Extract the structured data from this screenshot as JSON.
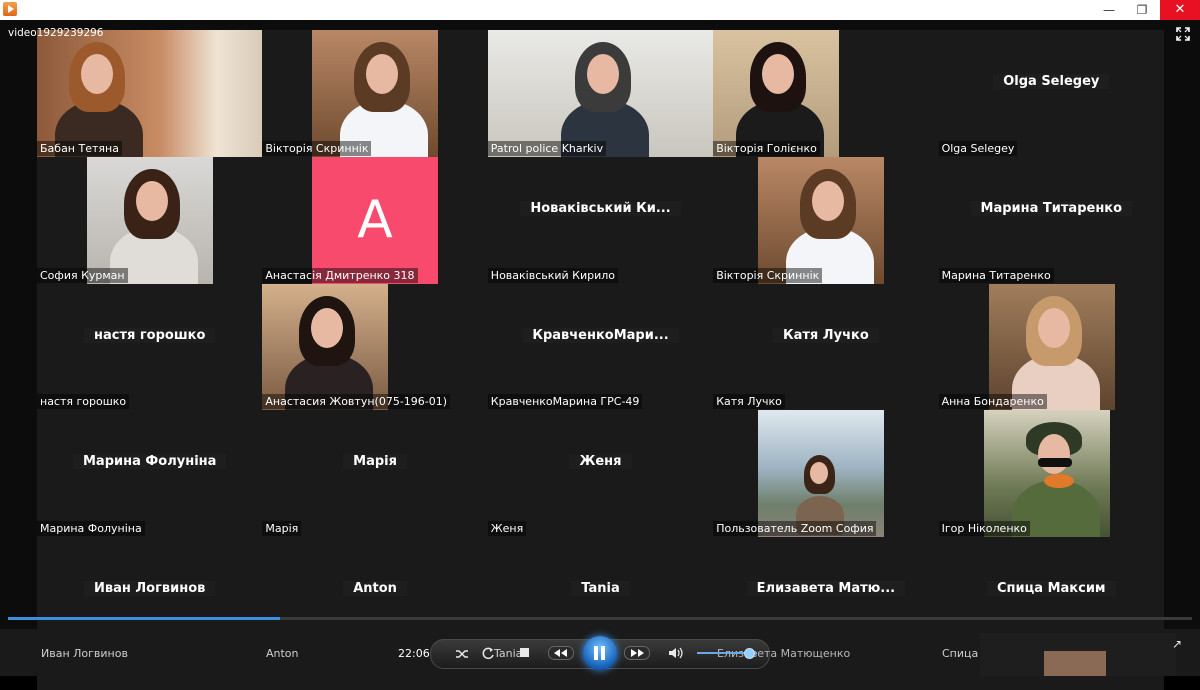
{
  "window": {
    "title": "video1929239296",
    "minimize": "—",
    "maximize": "❐",
    "close": "✕"
  },
  "gallery": {
    "tiles": [
      {
        "name": "Бабан Тетяна"
      },
      {
        "name": "Вікторія Скриннік"
      },
      {
        "name": "Patrol police Kharkiv"
      },
      {
        "name": "Вікторія Голієнко"
      },
      {
        "name": "Olga Selegey",
        "center": "Olga Selegey"
      },
      {
        "name": "София Курман"
      },
      {
        "name": "Анастасія Дмитренко 318",
        "avatar": "A",
        "avatar_color": "#f74a6c"
      },
      {
        "name": "Новаківський Кирило",
        "center": "Новаківський Ки..."
      },
      {
        "name": "Вікторія Скриннік"
      },
      {
        "name": "Марина Титаренко",
        "center": "Марина Титаренко"
      },
      {
        "name": "настя горошко",
        "center": "настя горошко"
      },
      {
        "name": "Анастасия Жовтун(075-196-01)"
      },
      {
        "name": "КравченкоМарина ГРС-49",
        "center": "КравченкоМари..."
      },
      {
        "name": "Катя Лучко",
        "center": "Катя Лучко"
      },
      {
        "name": "Анна Бондаренко"
      },
      {
        "name": "Марина Фолуніна",
        "center": "Марина Фолуніна"
      },
      {
        "name": "Марія",
        "center": "Марія"
      },
      {
        "name": "Женя",
        "center": "Женя"
      },
      {
        "name": "Пользователь Zoom София"
      },
      {
        "name": "Ігор Ніколенко"
      },
      {
        "center": "Иван Логвинов"
      },
      {
        "center": "Anton"
      },
      {
        "center": "Tania"
      },
      {
        "center": "Елизавета  Матю..."
      },
      {
        "center": "Спица Максим"
      }
    ]
  },
  "bottom_names": {
    "n1": "Иван Логвинов",
    "n2": "Anton",
    "n3": "Tania",
    "n4": "Елизавета Матющенко",
    "n5": "Спица"
  },
  "player": {
    "time": "22:06",
    "progress_fraction": 0.23,
    "volume_fraction": 0.85,
    "icons": {
      "shuffle": "shuffle-icon",
      "repeat": "repeat-icon",
      "stop": "stop-icon",
      "previous": "rewind-icon",
      "play_pause": "pause-icon",
      "next": "fast-forward-icon",
      "volume": "speaker-icon",
      "switch_view": "switch-to-library-icon"
    }
  }
}
